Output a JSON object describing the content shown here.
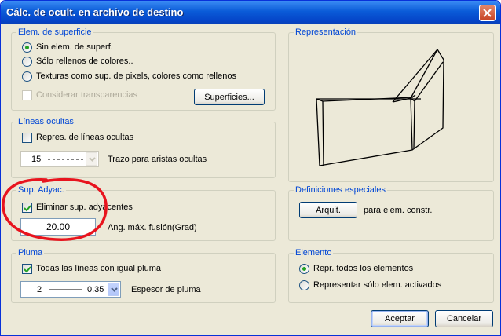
{
  "window": {
    "title": "Cálc. de ocult. en archivo de destino"
  },
  "superficie": {
    "legend": "Elem. de superficie",
    "options": [
      "Sin elem. de superf.",
      "Sólo rellenos de colores..",
      "Texturas como sup. de pixels, colores como rellenos"
    ],
    "selected_index": 0,
    "transparencias_label": "Considerar transparencias",
    "superficies_button": "Superficies..."
  },
  "representacion": {
    "legend": "Representación"
  },
  "lineas": {
    "legend": "Líneas ocultas",
    "repres_label": "Repres. de líneas ocultas",
    "repres_checked": false,
    "trazo_value": "15",
    "trazo_label": "Trazo para aristas ocultas"
  },
  "adyac": {
    "legend": "Sup. Adyac.",
    "eliminar_label": "Eliminar sup. adyacentes",
    "eliminar_checked": true,
    "angulo_value": "20.00",
    "angulo_label": "Ang. máx. fusión(Grad)"
  },
  "definiciones": {
    "legend": "Definiciones especiales",
    "arquit_button": "Arquit.",
    "arquit_label": "para elem. constr."
  },
  "pluma": {
    "legend": "Pluma",
    "todas_label": "Todas las líneas con igual pluma",
    "todas_checked": true,
    "pen_number": "2",
    "pen_width": "0.35",
    "espesor_label": "Espesor de pluma"
  },
  "elemento": {
    "legend": "Elemento",
    "options": [
      "Repr. todos los elementos",
      "Representar sólo elem. activados"
    ],
    "selected_index": 0
  },
  "buttons": {
    "accept": "Aceptar",
    "cancel": "Cancelar"
  },
  "colors": {
    "legend": "#0046d5",
    "annotation": "#e8141e",
    "titlebar": "#0a5bd8"
  }
}
